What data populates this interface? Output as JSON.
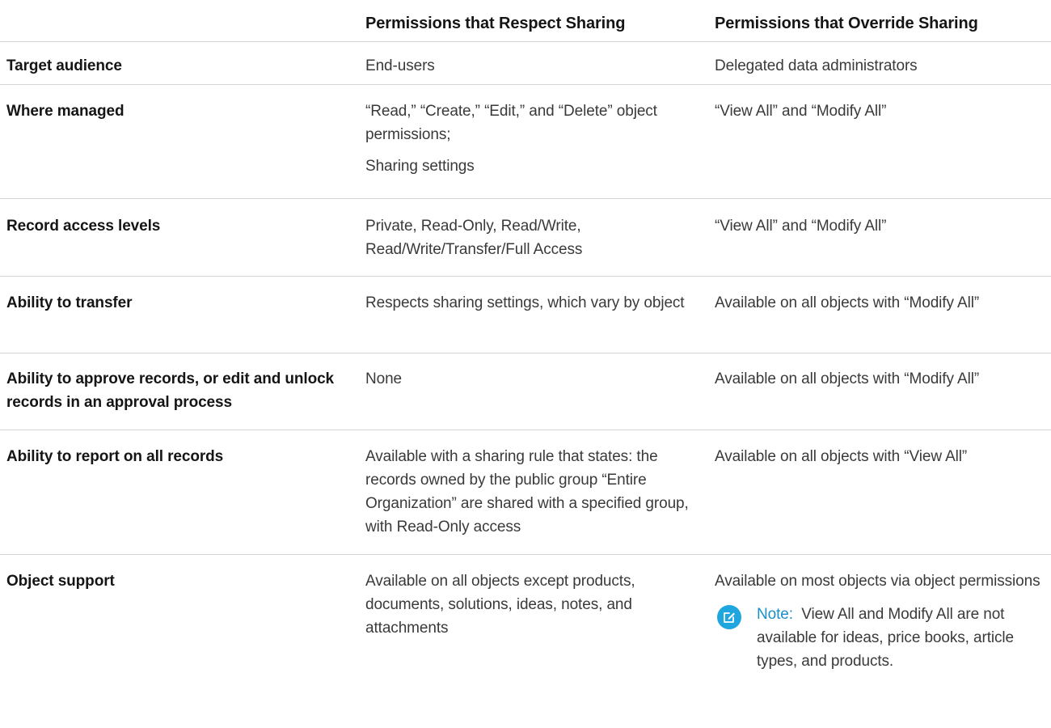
{
  "header": {
    "col1": "",
    "col2": "Permissions that Respect Sharing",
    "col3": "Permissions that Override Sharing"
  },
  "rows": [
    {
      "label": "Target audience",
      "respect": [
        "End-users"
      ],
      "override": "Delegated data administrators"
    },
    {
      "label": "Where managed",
      "respect": [
        "“Read,” “Create,” “Edit,” and “Delete” object permissions;",
        "Sharing settings"
      ],
      "override": "“View All” and “Modify All”"
    },
    {
      "label": "Record access levels",
      "respect": [
        "Private, Read-Only, Read/Write, Read/Write/Transfer/Full Access"
      ],
      "override": "“View All” and “Modify All”"
    },
    {
      "label": "Ability to transfer",
      "respect": [
        "Respects sharing settings, which vary by object"
      ],
      "override": "Available on all objects with “Modify All”"
    },
    {
      "label": "Ability to approve records, or edit and unlock records in an approval process",
      "respect": [
        "None"
      ],
      "override": "Available on all objects with “Modify All”"
    },
    {
      "label": "Ability to report on all records",
      "respect": [
        "Available with a sharing rule that states: the records owned by the public group “Entire Organization” are shared with a specified group, with Read-Only access"
      ],
      "override": "Available on all objects with “View All”"
    },
    {
      "label": "Object support",
      "respect": [
        "Available on all objects except products, documents, solutions, ideas, notes, and attachments"
      ],
      "override": "Available on most objects via object permissions",
      "note": {
        "label": "Note:",
        "text": "View All and Modify All are not available for ideas, price books, article types, and products.",
        "icon": "edit-note-icon",
        "color": "#1fa6de"
      }
    }
  ]
}
